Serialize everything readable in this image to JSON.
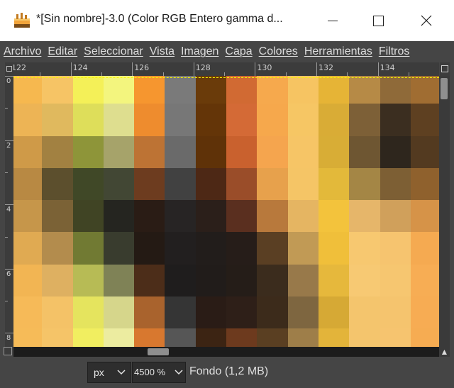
{
  "window": {
    "title": "*[Sin nombre]-3.0 (Color RGB Entero gamma d...",
    "minimize_glyph": "—",
    "maximize_glyph": "☐",
    "close_glyph": "✕"
  },
  "menubar": {
    "items": [
      {
        "label": "Archivo",
        "accel": "A"
      },
      {
        "label": "Editar",
        "accel": "E"
      },
      {
        "label": "Seleccionar",
        "accel": "S"
      },
      {
        "label": "Vista",
        "accel": "V"
      },
      {
        "label": "Imagen",
        "accel": "I"
      },
      {
        "label": "Capa",
        "accel": "C"
      },
      {
        "label": "Colores",
        "accel": "C"
      },
      {
        "label": "Herramientas",
        "accel": "H"
      },
      {
        "label": "Filtros",
        "accel": "F"
      }
    ]
  },
  "rulers": {
    "horizontal_labels": [
      "122",
      "124",
      "126",
      "128",
      "130",
      "132",
      "134"
    ],
    "vertical_labels": [
      "0",
      "2",
      "4",
      "6",
      "8"
    ]
  },
  "canvas": {
    "pixel_colors": [
      [
        "#f6b84f",
        "#f6c465",
        "#f4f058",
        "#f3f57e",
        "#f6962f",
        "#7a7a7a",
        "#6a3b0a",
        "#d16a33",
        "#f6a94d",
        "#f6c462",
        "#e6b436",
        "#b68a46",
        "#8f6a39",
        "#a06d32"
      ],
      [
        "#edb455",
        "#e0b95e",
        "#dede5a",
        "#dede8f",
        "#ee8c2e",
        "#777777",
        "#643508",
        "#d46a36",
        "#f6a84c",
        "#f6c664",
        "#d9ac36",
        "#7d6037",
        "#3b2e20",
        "#5e4021"
      ],
      [
        "#cf9a48",
        "#a28141",
        "#8e9539",
        "#a6a36a",
        "#bd7334",
        "#6a6a6a",
        "#5f3208",
        "#c9612e",
        "#f5a54e",
        "#f6c566",
        "#d8ad36",
        "#6e5632",
        "#2e261d",
        "#533a20"
      ],
      [
        "#b88943",
        "#5c4f2d",
        "#404827",
        "#424734",
        "#6d3c1f",
        "#414141",
        "#4d2815",
        "#9a4d29",
        "#e7a14c",
        "#f5c566",
        "#e3b93a",
        "#a48645",
        "#7d5f34",
        "#8f612d"
      ],
      [
        "#c6964a",
        "#7b6236",
        "#404424",
        "#252520",
        "#2a1c15",
        "#272424",
        "#2b1f1a",
        "#5a2f1f",
        "#b8793c",
        "#e5b562",
        "#f3c33c",
        "#e6b66a",
        "#d0a05b",
        "#d69348"
      ],
      [
        "#e0aa52",
        "#b38c4d",
        "#717a33",
        "#393c2e",
        "#241a14",
        "#221f1f",
        "#221d1b",
        "#261d19",
        "#5a3f23",
        "#c19a55",
        "#f0bf3a",
        "#f7c870",
        "#f6c46f",
        "#f5aa51"
      ],
      [
        "#f2b553",
        "#deb061",
        "#b7bb55",
        "#7f8256",
        "#4c2d19",
        "#1f1d1d",
        "#211c1a",
        "#251d18",
        "#3b2c1d",
        "#98794a",
        "#e6b83c",
        "#f7c973",
        "#f6c670",
        "#f7ad54"
      ],
      [
        "#f6ba58",
        "#f4c267",
        "#e5e45e",
        "#d6d68b",
        "#a9632d",
        "#353535",
        "#2a1c16",
        "#2e1f18",
        "#3c2b1b",
        "#7e6640",
        "#d6a935",
        "#f4c56d",
        "#f5c46e",
        "#f7ac53"
      ],
      [
        "#f6bb58",
        "#f5c468",
        "#f1ee60",
        "#ececa0",
        "#d8782f",
        "#565656",
        "#3c2413",
        "#6d3a1e",
        "#5a3f22",
        "#9e7e49",
        "#e3b43a",
        "#f4c56d",
        "#f6c46f",
        "#f6ac52"
      ]
    ]
  },
  "statusbar": {
    "unit": "px",
    "zoom": "4500 %",
    "layer_info": "Fondo (1,2 MB)"
  }
}
